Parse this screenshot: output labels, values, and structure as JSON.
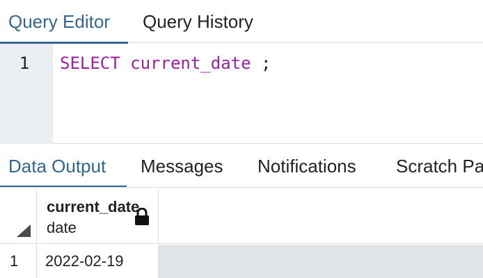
{
  "editor_tabs": [
    {
      "label": "Query Editor",
      "active": true
    },
    {
      "label": "Query History",
      "active": false
    }
  ],
  "editor": {
    "line_number": "1",
    "keyword": "SELECT",
    "function": "current_date",
    "terminator": " ;"
  },
  "result_tabs": [
    {
      "label": "Data Output",
      "active": true
    },
    {
      "label": "Messages",
      "active": false
    },
    {
      "label": "Notifications",
      "active": false
    },
    {
      "label": "Scratch Pa",
      "active": false
    }
  ],
  "grid": {
    "column": {
      "name": "current_date",
      "type": "date",
      "icon": "lock-icon"
    },
    "rows": [
      {
        "row_number": "1",
        "value": "2022-02-19"
      }
    ]
  },
  "colors": {
    "accent": "#326690",
    "keyword": "#9b1fa0",
    "gutter": "#eaedf2",
    "row_filler": "#e0e3e7"
  }
}
